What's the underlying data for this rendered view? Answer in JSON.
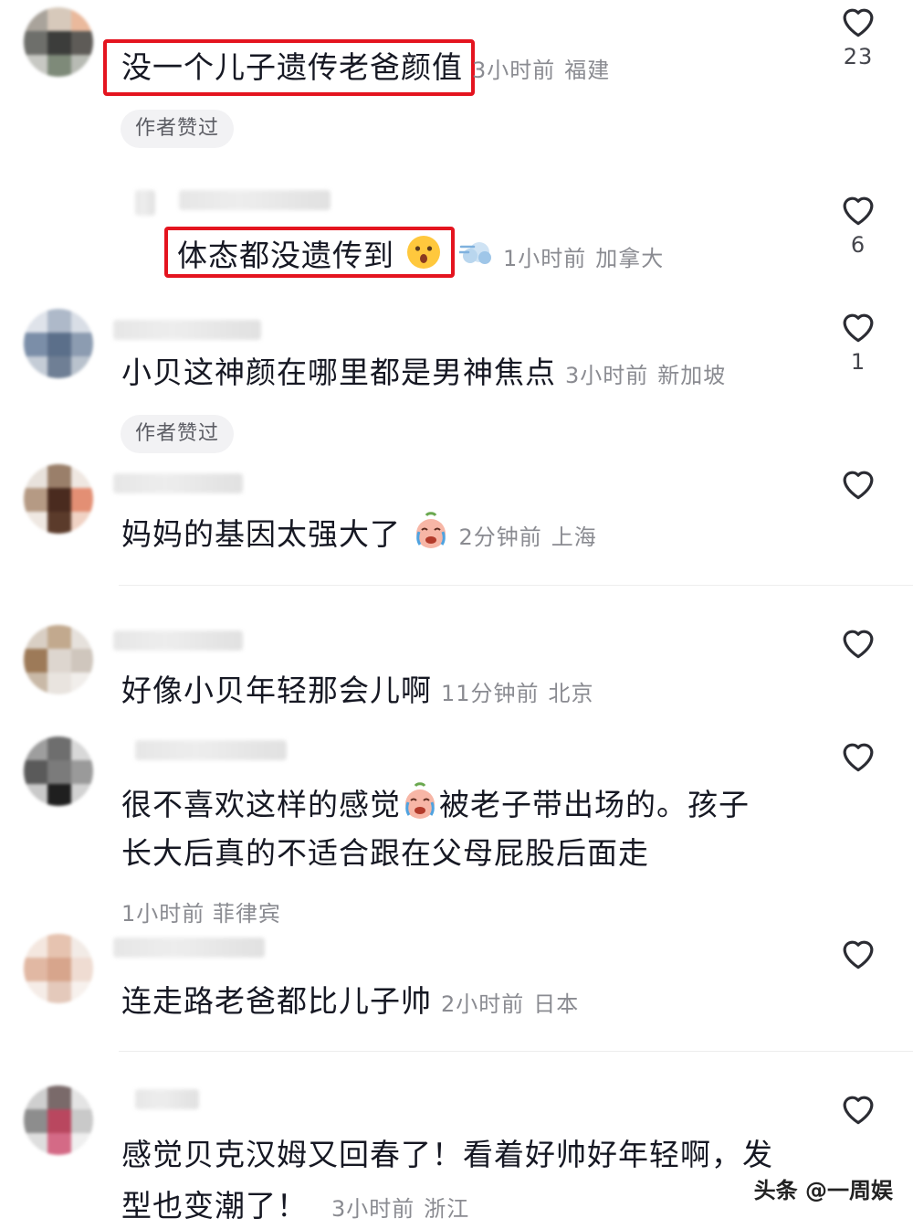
{
  "comments": [
    {
      "text": "没一个儿子遗传老爸颜值",
      "time": "3小时前",
      "location": "福建",
      "likes": "23",
      "badge": "作者赞过"
    },
    {
      "text": "体态都没遗传到",
      "emoji": "astonished-face-emoji",
      "emoji2": "dash-emoji",
      "time": "1小时前",
      "location": "加拿大",
      "likes": "6"
    },
    {
      "text": "小贝这神颜在哪里都是男神焦点",
      "time": "3小时前",
      "location": "新加坡",
      "likes": "1",
      "badge": "作者赞过"
    },
    {
      "text": "妈妈的基因太强大了",
      "emoji": "crying-face-emoji",
      "time": "2分钟前",
      "location": "上海",
      "likes": ""
    },
    {
      "text": "好像小贝年轻那会儿啊",
      "time": "11分钟前",
      "location": "北京",
      "likes": ""
    },
    {
      "line1_a": "很不喜欢这样的感觉",
      "emoji": "crying-face-emoji",
      "line1_b": "被老子带出场的。孩子",
      "line2": "长大后真的不适合跟在父母屁股后面走",
      "time": "1小时前",
      "location": "菲律宾",
      "likes": ""
    },
    {
      "text": "连走路老爸都比儿子帅",
      "time": "2小时前",
      "location": "日本",
      "likes": ""
    },
    {
      "line1": "感觉贝克汉姆又回春了！看着好帅好年轻啊，发",
      "line2": "型也变潮了！",
      "time": "3小时前",
      "location": "浙江",
      "likes": ""
    }
  ],
  "watermark": "头条 @一周娱",
  "colors": {
    "highlight_box": "#e4141f",
    "meta_text": "#8a8b91",
    "badge_bg": "#f2f2f4"
  },
  "icons": {
    "like": "heart-outline-icon"
  }
}
